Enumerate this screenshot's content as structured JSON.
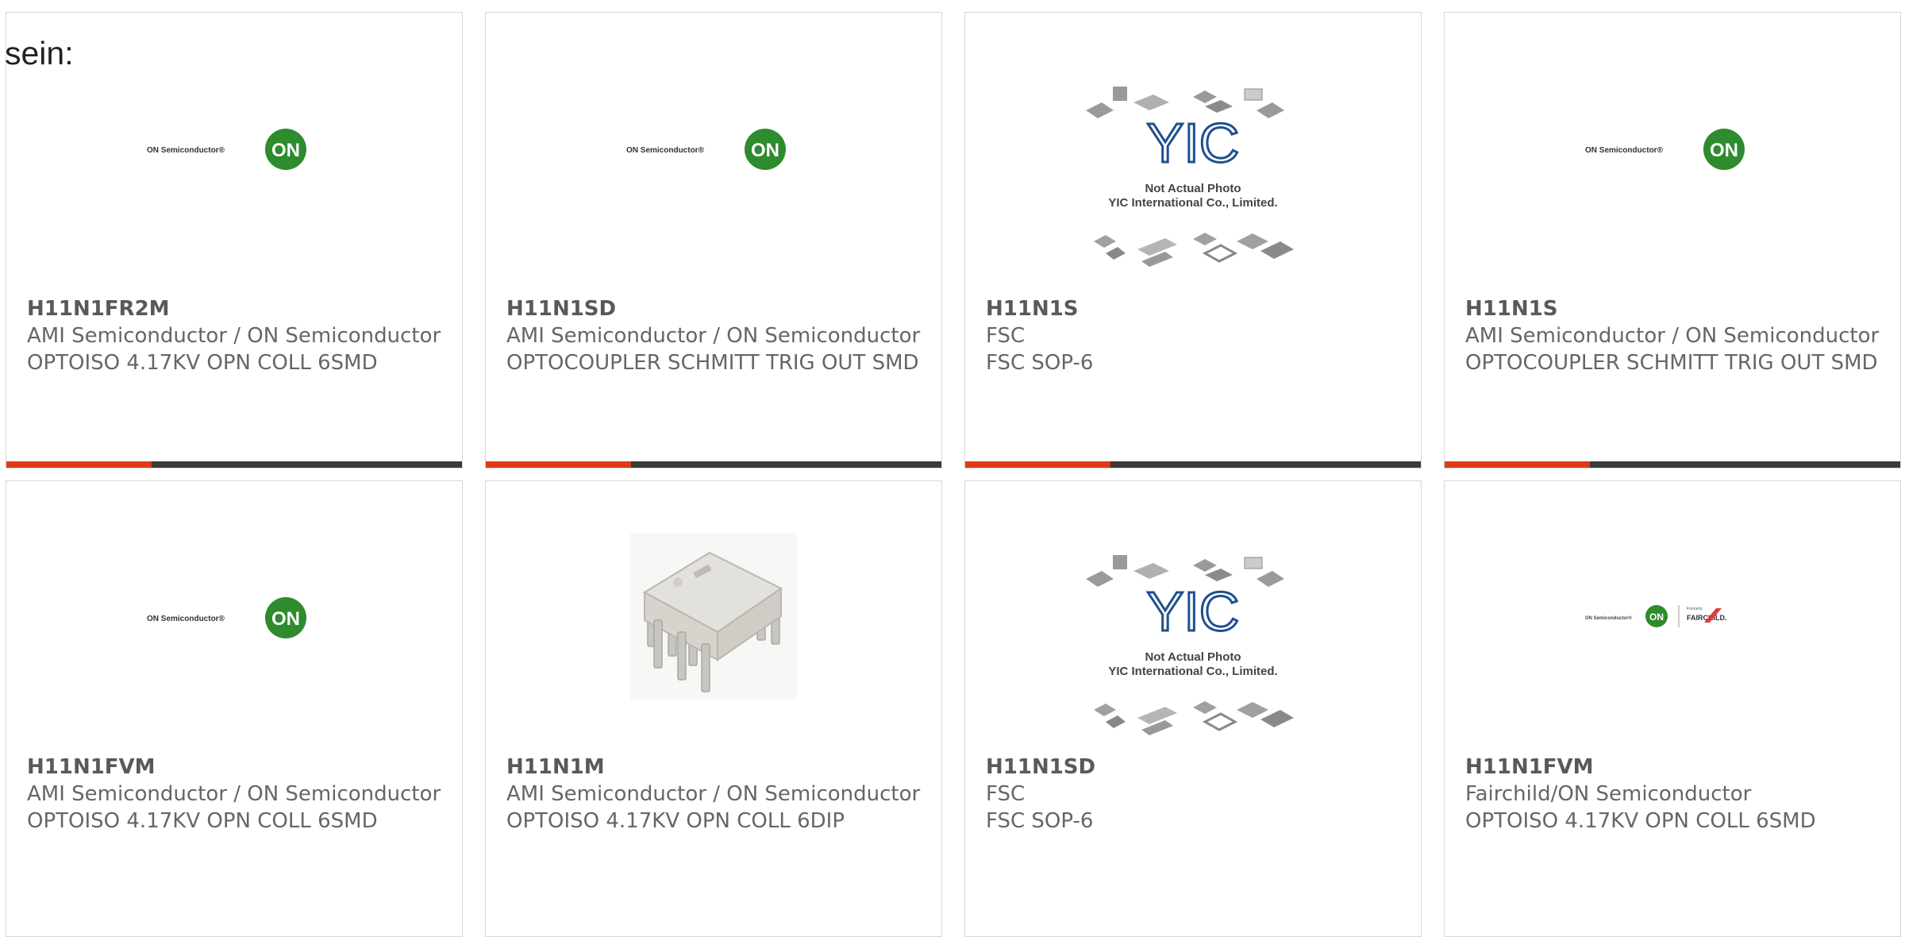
{
  "page": {
    "label": "sein:"
  },
  "colors": {
    "accent": "#e03a12",
    "bar": "#3a3a3a",
    "on_green": "#2e8b2e",
    "yic_blue": "#1f4f8f"
  },
  "cards": [
    {
      "part": "H11N1FR2M",
      "manufacturer": "AMI Semiconductor / ON Semiconductor",
      "description": "OPTOISO 4.17KV OPN COLL 6SMD",
      "image": "on-semiconductor-logo"
    },
    {
      "part": "H11N1SD",
      "manufacturer": "AMI Semiconductor / ON Semiconductor",
      "description": "OPTOCOUPLER SCHMITT TRIG OUT SMD",
      "image": "on-semiconductor-logo"
    },
    {
      "part": "H11N1S",
      "manufacturer": "FSC",
      "description": "FSC SOP-6",
      "image": "yic-not-actual-photo"
    },
    {
      "part": "H11N1S",
      "manufacturer": "AMI Semiconductor / ON Semiconductor",
      "description": "OPTOCOUPLER SCHMITT TRIG OUT SMD",
      "image": "on-semiconductor-logo"
    },
    {
      "part": "H11N1FVM",
      "manufacturer": "AMI Semiconductor / ON Semiconductor",
      "description": "OPTOISO 4.17KV OPN COLL 6SMD",
      "image": "on-semiconductor-logo"
    },
    {
      "part": "H11N1M",
      "manufacturer": "AMI Semiconductor / ON Semiconductor",
      "description": "OPTOISO 4.17KV OPN COLL 6DIP",
      "image": "dip6-chip-photo"
    },
    {
      "part": "H11N1SD",
      "manufacturer": "FSC",
      "description": "FSC SOP-6",
      "image": "yic-not-actual-photo"
    },
    {
      "part": "H11N1FVM",
      "manufacturer": "Fairchild/ON Semiconductor",
      "description": "OPTOISO 4.17KV OPN COLL 6SMD",
      "image": "fairchild-on-logo"
    }
  ],
  "logos": {
    "on_text": "ON Semiconductor®",
    "on_badge": "ON",
    "yic_mark": "YIC",
    "yic_line1": "Not Actual Photo",
    "yic_line2": "YIC International Co., Limited.",
    "formerly": "Formerly",
    "fairchild": "FAIRCHILD."
  }
}
